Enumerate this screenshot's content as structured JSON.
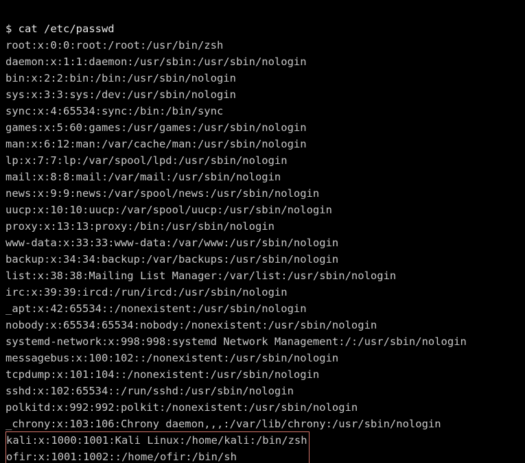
{
  "prompt": "$ cat /etc/passwd",
  "lines": [
    "root:x:0:0:root:/root:/usr/bin/zsh",
    "daemon:x:1:1:daemon:/usr/sbin:/usr/sbin/nologin",
    "bin:x:2:2:bin:/bin:/usr/sbin/nologin",
    "sys:x:3:3:sys:/dev:/usr/sbin/nologin",
    "sync:x:4:65534:sync:/bin:/bin/sync",
    "games:x:5:60:games:/usr/games:/usr/sbin/nologin",
    "man:x:6:12:man:/var/cache/man:/usr/sbin/nologin",
    "lp:x:7:7:lp:/var/spool/lpd:/usr/sbin/nologin",
    "mail:x:8:8:mail:/var/mail:/usr/sbin/nologin",
    "news:x:9:9:news:/var/spool/news:/usr/sbin/nologin",
    "uucp:x:10:10:uucp:/var/spool/uucp:/usr/sbin/nologin",
    "proxy:x:13:13:proxy:/bin:/usr/sbin/nologin",
    "www-data:x:33:33:www-data:/var/www:/usr/sbin/nologin",
    "backup:x:34:34:backup:/var/backups:/usr/sbin/nologin",
    "list:x:38:38:Mailing List Manager:/var/list:/usr/sbin/nologin",
    "irc:x:39:39:ircd:/run/ircd:/usr/sbin/nologin",
    "_apt:x:42:65534::/nonexistent:/usr/sbin/nologin",
    "nobody:x:65534:65534:nobody:/nonexistent:/usr/sbin/nologin",
    "systemd-network:x:998:998:systemd Network Management:/:/usr/sbin/nologin",
    "messagebus:x:100:102::/nonexistent:/usr/sbin/nologin",
    "tcpdump:x:101:104::/nonexistent:/usr/sbin/nologin",
    "sshd:x:102:65534::/run/sshd:/usr/sbin/nologin",
    "polkitd:x:992:992:polkit:/nonexistent:/usr/sbin/nologin",
    "_chrony:x:103:106:Chrony daemon,,,:/var/lib/chrony:/usr/sbin/nologin"
  ],
  "highlighted": [
    "kali:x:1000:1001:Kali Linux:/home/kali:/bin/zsh",
    "ofir:x:1001:1002::/home/ofir:/bin/sh"
  ]
}
